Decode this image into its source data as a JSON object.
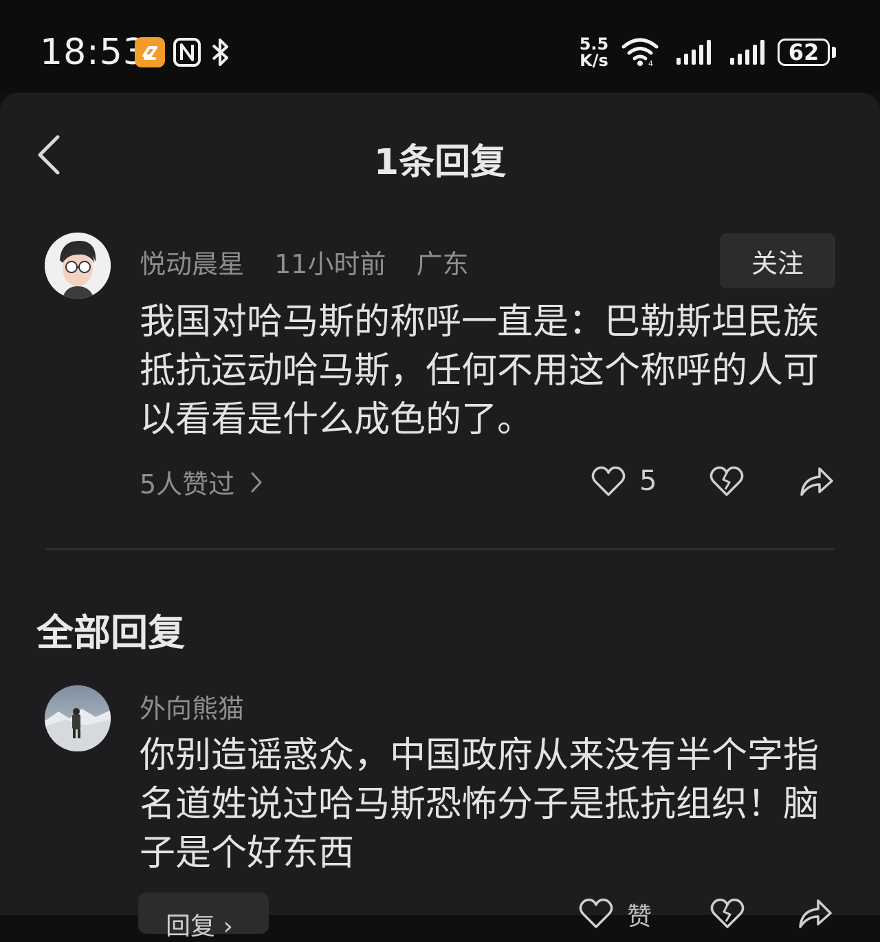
{
  "status_bar": {
    "time": "18:53",
    "net_speed_value": "5.5",
    "net_speed_unit": "K/s",
    "battery": "62",
    "icons": [
      "app-badge-icon",
      "nfc-icon",
      "bluetooth-icon",
      "wifi-icon",
      "signal-icon",
      "signal-icon",
      "battery-icon"
    ]
  },
  "header": {
    "title": "1条回复"
  },
  "main_comment": {
    "author": "悦动晨星",
    "time": "11小时前",
    "location": "广东",
    "follow_label": "关注",
    "text": "我国对哈马斯的称呼一直是：巴勒斯坦民族抵抗运动哈马斯，任何不用这个称呼的人可以看看是什么成色的了。",
    "likers_label": "5人赞过",
    "like_count": "5"
  },
  "replies_section": {
    "title": "全部回复",
    "replies": [
      {
        "author": "外向熊猫",
        "text": "你别造谣惑众，中国政府从来没有半个字指名道姓说过哈马斯恐怖分子是抵抗组织！脑子是个好东西",
        "reply_label": "回复 ›",
        "like_label": "赞"
      }
    ]
  },
  "colors": {
    "background": "#1d1d1f",
    "status_bar": "#0d0d0d",
    "badge": "#f39c2a",
    "button_bg": "#2c2c2e"
  }
}
